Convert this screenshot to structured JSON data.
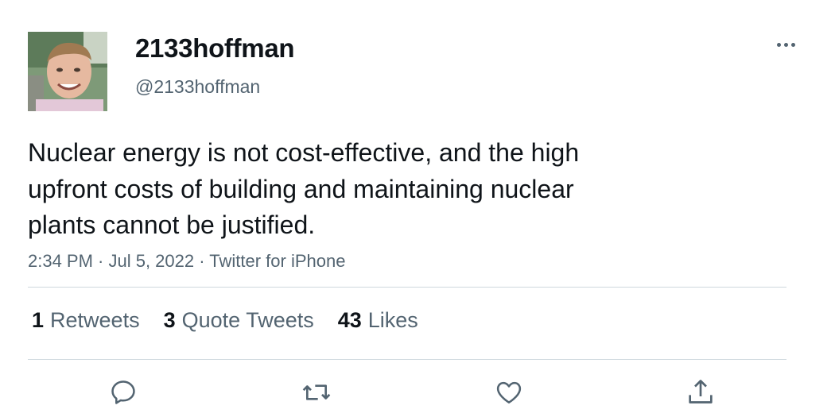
{
  "user": {
    "display_name": "2133hoffman",
    "handle": "@2133hoffman"
  },
  "tweet": {
    "text_lines": [
      "Nuclear energy is not cost-effective, and the high",
      "upfront costs of building and maintaining nuclear",
      "plants cannot be justified."
    ],
    "meta": "2:34 PM · Jul 5, 2022 · Twitter for iPhone"
  },
  "stats": [
    {
      "count": "1",
      "label": "Retweets"
    },
    {
      "count": "3",
      "label": "Quote Tweets"
    },
    {
      "count": "43",
      "label": "Likes"
    }
  ],
  "actions": {
    "reply_icon": "reply-icon",
    "retweet_icon": "retweet-icon",
    "like_icon": "heart-icon",
    "share_icon": "share-icon",
    "more_icon": "more-options-icon"
  },
  "colors": {
    "text_primary": "#0f1419",
    "text_secondary": "#536471",
    "divider": "#cfd9de"
  }
}
